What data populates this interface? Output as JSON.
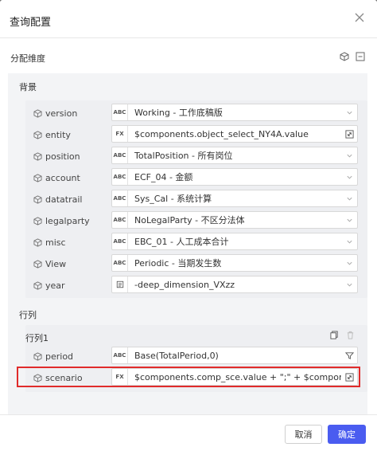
{
  "dialog": {
    "title": "查询配置"
  },
  "section": {
    "label": "分配维度"
  },
  "background": {
    "label": "背景"
  },
  "rows_bg": [
    {
      "name": "version",
      "tag": "ABC",
      "value": "Working - 工作底稿版",
      "suffix": "chevron-down-icon"
    },
    {
      "name": "entity",
      "tag": "FX",
      "value": "$components.object_select_NY4A.value",
      "suffix": "expand-icon"
    },
    {
      "name": "position",
      "tag": "ABC",
      "value": "TotalPosition - 所有岗位",
      "suffix": "chevron-down-icon"
    },
    {
      "name": "account",
      "tag": "ABC",
      "value": "ECF_04 - 金额",
      "suffix": "chevron-down-icon"
    },
    {
      "name": "datatrail",
      "tag": "ABC",
      "value": "Sys_Cal - 系统计算",
      "suffix": "chevron-down-icon"
    },
    {
      "name": "legalparty",
      "tag": "ABC",
      "value": "NoLegalParty - 不区分法体",
      "suffix": "chevron-down-icon"
    },
    {
      "name": "misc",
      "tag": "ABC",
      "value": "EBC_01 - 人工成本合计",
      "suffix": "chevron-down-icon"
    },
    {
      "name": "View",
      "tag": "ABC",
      "value": "Periodic - 当期发生数",
      "suffix": "chevron-down-icon"
    },
    {
      "name": "year",
      "tag": "list-icon",
      "value": "-deep_dimension_VXzz",
      "suffix": "chevron-down-icon"
    }
  ],
  "rowcol": {
    "label": "行列",
    "sub_label": "行列1"
  },
  "rows_rc": [
    {
      "name": "period",
      "tag": "ABC",
      "value": "Base(TotalPeriod,0)",
      "suffix": "filter-icon"
    },
    {
      "name": "scenario",
      "tag": "FX",
      "value": "$components.comp_sce.value + \";\" + $components.base_",
      "suffix": "expand-icon"
    }
  ],
  "footer": {
    "cancel": "取消",
    "ok": "确定"
  }
}
